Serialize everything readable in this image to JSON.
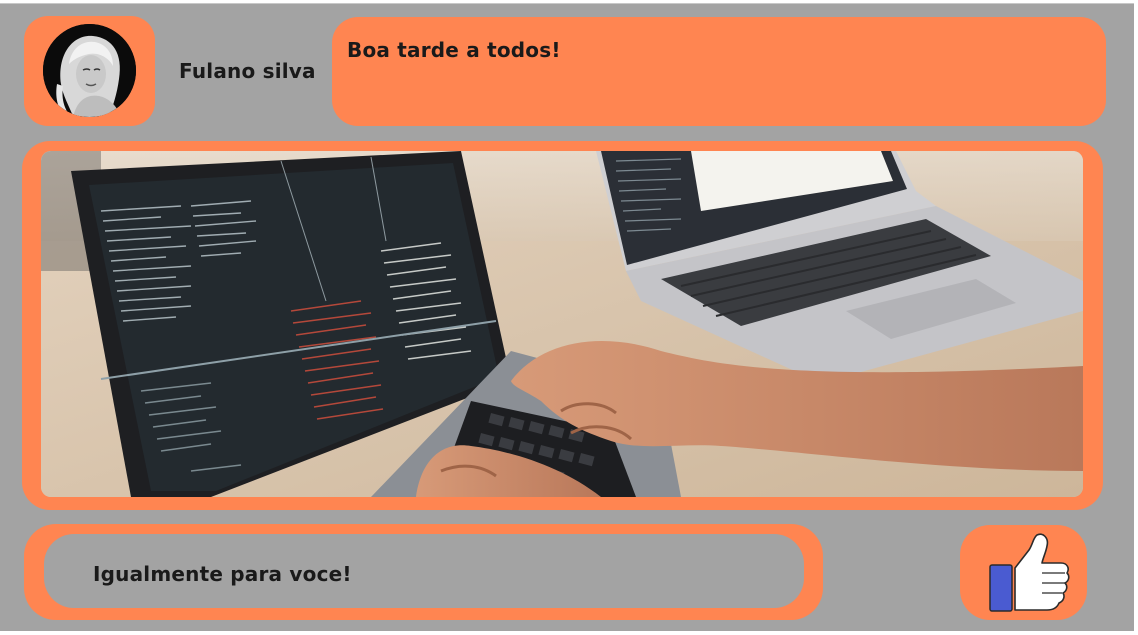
{
  "post": {
    "author_name": "Fulano silva",
    "avatar_icon": "user-avatar-photo",
    "message": "Boa tarde a todos!",
    "image_icon": "laptop-coding-photo"
  },
  "reply": {
    "text": "Igualmente para voce!"
  },
  "actions": {
    "like_icon": "thumbs-up-icon"
  },
  "colors": {
    "accent": "#ff8551",
    "background": "#a3a3a3",
    "like_blue": "#4a5bd1"
  }
}
